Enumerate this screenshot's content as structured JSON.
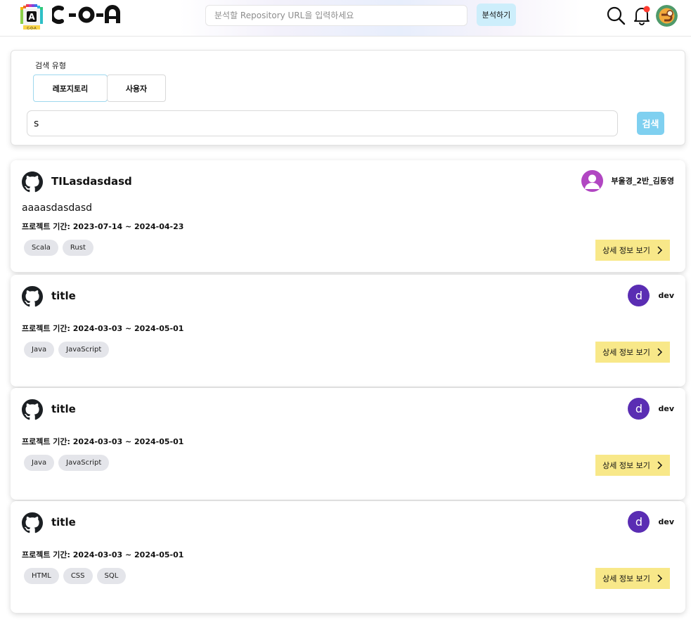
{
  "header": {
    "logo_text": "C-O-A",
    "url_placeholder": "분석할 Repository URL을 입력하세요",
    "analyze_label": "분석하기",
    "icons": [
      "search-icon",
      "bell-icon",
      "user-avatar"
    ],
    "notification_dot_color": "#ff3b30"
  },
  "search": {
    "type_label": "검색 유형",
    "tabs": [
      {
        "label": "레포지토리",
        "active": true
      },
      {
        "label": "사용자",
        "active": false
      }
    ],
    "query_value": "s",
    "button_label": "검색",
    "accent_color": "#7fd0f0"
  },
  "period_prefix": "프로젝트 기간: ",
  "detail_label": "상세 정보 보기",
  "repos": [
    {
      "title": "TILasdasdasd",
      "owner": "부울경_2반_김동영",
      "owner_avatar": "person-icon",
      "description": "aaaasdasdasd",
      "period": "2023-07-14 ~ 2024-04-23",
      "tags": [
        "Scala",
        "Rust"
      ]
    },
    {
      "title": "title",
      "owner": "dev",
      "owner_avatar": "d",
      "description": "",
      "period": "2024-03-03 ~ 2024-05-01",
      "tags": [
        "Java",
        "JavaScript"
      ]
    },
    {
      "title": "title",
      "owner": "dev",
      "owner_avatar": "d",
      "description": "",
      "period": "2024-03-03 ~ 2024-05-01",
      "tags": [
        "Java",
        "JavaScript"
      ]
    },
    {
      "title": "title",
      "owner": "dev",
      "owner_avatar": "d",
      "description": "",
      "period": "2024-03-03 ~ 2024-05-01",
      "tags": [
        "HTML",
        "CSS",
        "SQL"
      ]
    }
  ]
}
